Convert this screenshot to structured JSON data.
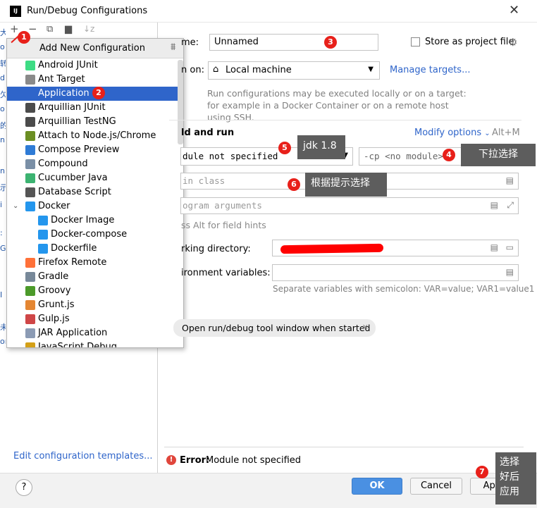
{
  "window": {
    "title": "Run/Debug Configurations",
    "logo": "IJ",
    "close": "✕"
  },
  "left_margin_glyphs": [
    "大",
    "o",
    "转",
    "d",
    "欠",
    "o",
    "的",
    "n",
    "n",
    "示",
    "i",
    ":",
    "G",
    "I",
    "未",
    "or"
  ],
  "toolbar": {
    "add_icon": "plus-icon",
    "remove_icon": "minus-icon",
    "copy_icon": "copy-icon",
    "folder_icon": "folder-add-icon",
    "sort_icon": "sort-icon"
  },
  "popup": {
    "title": "Add New Configuration",
    "items": [
      {
        "label": "Android JUnit",
        "color": "#3ddc84"
      },
      {
        "label": "Ant Target",
        "color": "#8a8a8a"
      },
      {
        "label": "Application",
        "color": "#2f65ca"
      },
      {
        "label": "Arquillian JUnit",
        "color": "#4b4b4b"
      },
      {
        "label": "Arquillian TestNG",
        "color": "#4b4b4b"
      },
      {
        "label": "Attach to Node.js/Chrome",
        "color": "#6b8e23"
      },
      {
        "label": "Compose Preview",
        "color": "#2e7bd6"
      },
      {
        "label": "Compound",
        "color": "#7a8fa6"
      },
      {
        "label": "Cucumber Java",
        "color": "#3cb371"
      },
      {
        "label": "Database Script",
        "color": "#555555"
      },
      {
        "label": "Docker",
        "color": "#2496ed"
      },
      {
        "label": "Docker Image",
        "color": "#2496ed"
      },
      {
        "label": "Docker-compose",
        "color": "#2496ed"
      },
      {
        "label": "Dockerfile",
        "color": "#2496ed"
      },
      {
        "label": "Firefox Remote",
        "color": "#ff7139"
      },
      {
        "label": "Gradle",
        "color": "#778899"
      },
      {
        "label": "Groovy",
        "color": "#4c9a2a"
      },
      {
        "label": "Grunt.js",
        "color": "#e48632"
      },
      {
        "label": "Gulp.js",
        "color": "#cf4647"
      },
      {
        "label": "JAR Application",
        "color": "#8b9bb4"
      },
      {
        "label": "JavaScript Debug",
        "color": "#d4a017"
      }
    ]
  },
  "form": {
    "name_label": "me:",
    "name_value": "Unnamed",
    "store_label": "Store as project file",
    "run_on_label": "n on:",
    "run_on_value": "Local machine",
    "manage_targets": "Manage targets...",
    "run_hint": "Run configurations may be executed locally or on a target: for example in a Docker Container or on a remote host using SSH.",
    "section_title": "ld and run",
    "modify_options": "Modify options",
    "modify_shortcut": "Alt+M",
    "module_value": "dule not specified",
    "cp_value": "-cp <no module>",
    "main_class_placeholder": "in class",
    "program_args_placeholder": "ogram arguments",
    "alt_hint": "ss Alt for field hints",
    "working_dir_label": "rking directory:",
    "env_label": "ironment variables:",
    "env_hint": "Separate variables with semicolon: VAR=value; VAR1=value1",
    "open_tool_window": "Open run/debug tool window when started",
    "chip_close": "✕"
  },
  "left_footer": {
    "templates_link": "Edit configuration templates..."
  },
  "error": {
    "prefix": "Error:",
    "message": "Module not specified"
  },
  "buttons": {
    "ok": "OK",
    "cancel": "Cancel",
    "apply": "Apply",
    "help": "?"
  },
  "annotations": {
    "b1": "1",
    "b2": "2",
    "b3": "3",
    "b4": "4",
    "b5": "5",
    "b6": "6",
    "b7": "7",
    "tip_jdk": "jdk 1.8",
    "tip_dropdown": "下拉选择",
    "tip_hint": "根据提示选择",
    "tip_apply_1": "选择",
    "tip_apply_2": "好后",
    "tip_apply_3": "应用",
    "badge_color": "#e8201a"
  }
}
